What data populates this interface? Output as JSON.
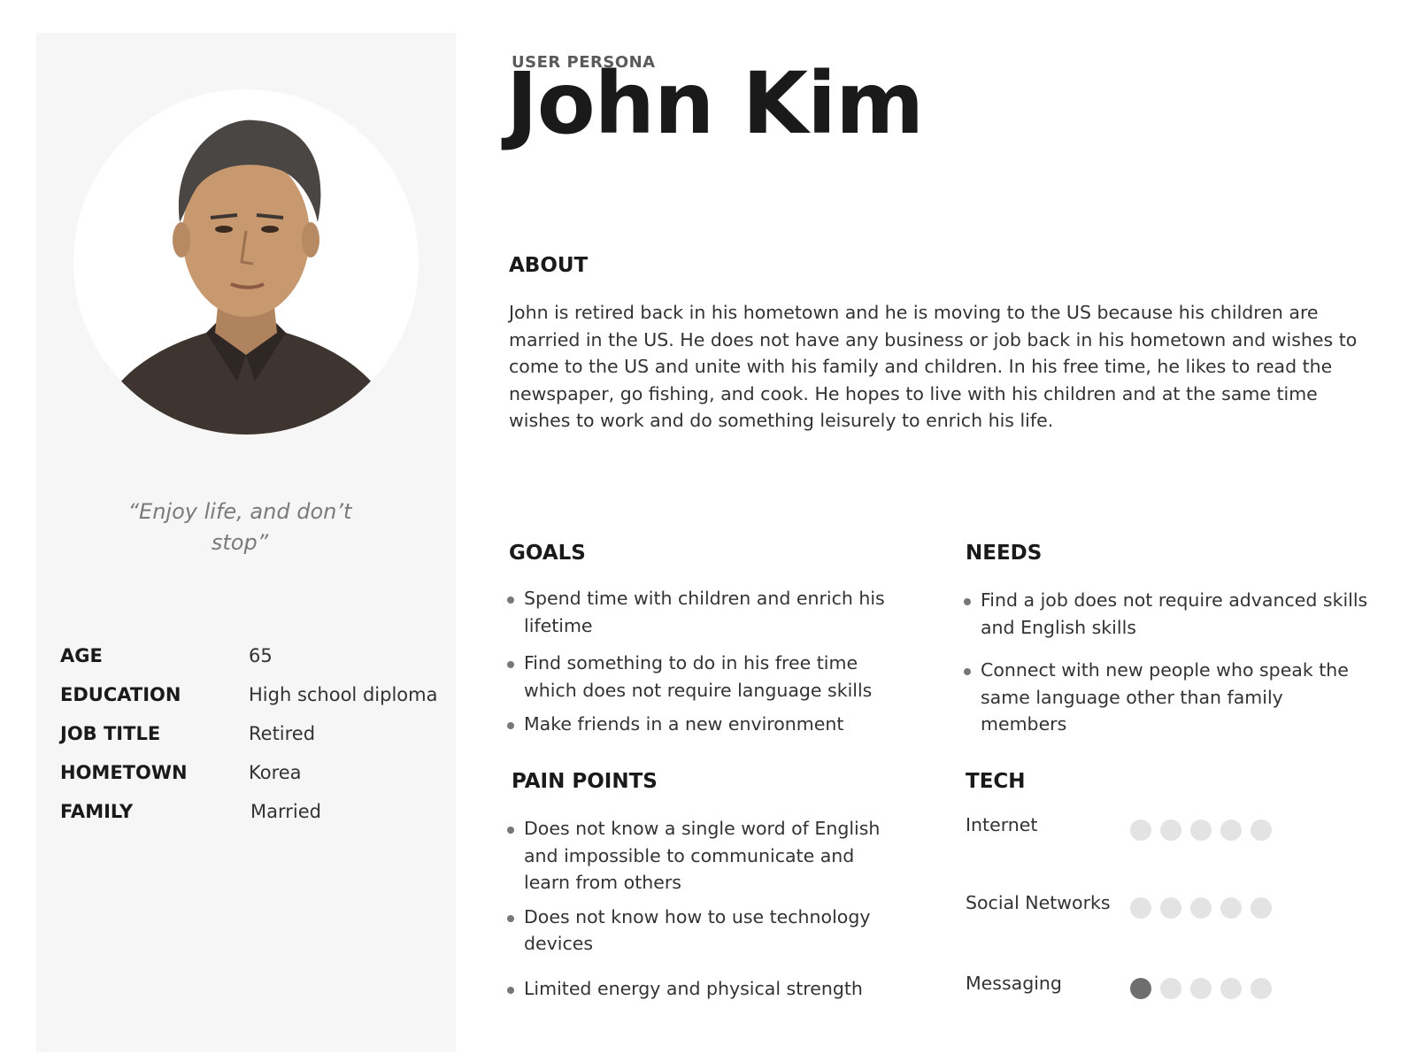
{
  "header": {
    "kicker": "USER PERSONA",
    "name": "John Kim"
  },
  "profile": {
    "photo_icon": "portrait-photo",
    "quote": "“Enjoy life, and don’t stop”",
    "info": [
      {
        "label": "AGE",
        "value": "65"
      },
      {
        "label": "EDUCATION",
        "value": "High school diploma"
      },
      {
        "label": "JOB TITLE",
        "value": "Retired"
      },
      {
        "label": "HOMETOWN",
        "value": "Korea"
      },
      {
        "label": "FAMILY",
        "value": "Married"
      }
    ]
  },
  "about": {
    "heading": "ABOUT",
    "text": "John is retired back in his hometown and he is moving to the US because his children are married in the US. He does not have any business or job back in his hometown and wishes to come to the US and unite with his family and children. In his free time, he likes to read the newspaper, go fishing, and cook. He hopes to live with his children and at the same time wishes to work and do something leisurely to enrich his life."
  },
  "goals": {
    "heading": "GOALS",
    "items": [
      "Spend time with children and enrich his lifetime",
      "Find something to do in his free time which does not require language skills",
      "Make friends in a new environment"
    ]
  },
  "needs": {
    "heading": "NEEDS",
    "items": [
      "Find a job does not require advanced skills and English skills",
      "Connect with new people who speak the same language other than family members"
    ]
  },
  "pain_points": {
    "heading": "PAIN POINTS",
    "items": [
      "Does not know a single word of English and impossible to communicate and learn from others",
      "Does not know how to use technology devices",
      "Limited energy and physical strength"
    ]
  },
  "tech": {
    "heading": "TECH",
    "scale_max": 5,
    "items": [
      {
        "label": "Internet",
        "level": 0
      },
      {
        "label": "Social Networks",
        "level": 0
      },
      {
        "label": "Messaging",
        "level": 1
      }
    ]
  },
  "colors": {
    "sidebar_bg": "#f6f6f6",
    "dot_empty": "#e3e3e3",
    "dot_filled": "#6e6e6e"
  }
}
